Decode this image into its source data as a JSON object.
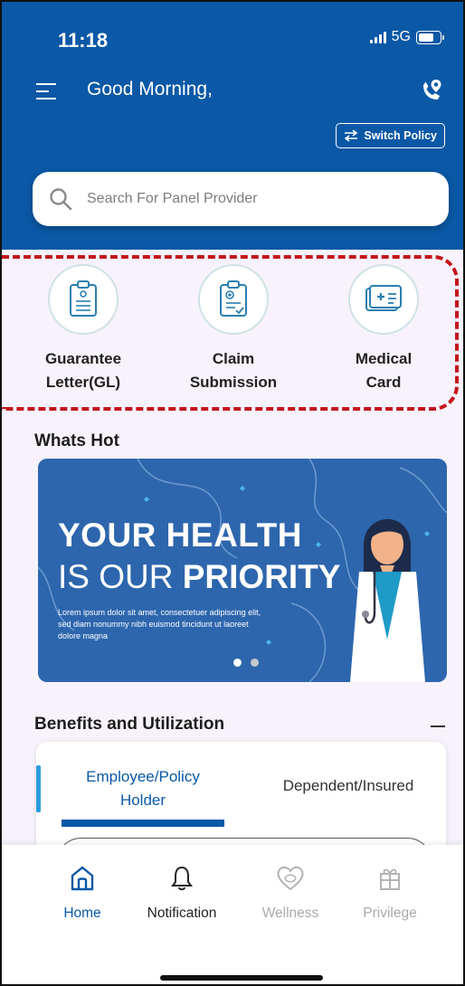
{
  "status_bar": {
    "time": "11:18",
    "network": "5G"
  },
  "header": {
    "greeting": "Good Morning,",
    "switch_policy_label": "Switch Policy",
    "background_color": "#0a58a6"
  },
  "search": {
    "placeholder": "Search For Panel Provider"
  },
  "quick_actions": [
    {
      "label_line1": "Guarantee",
      "label_line2": "Letter(GL)",
      "icon": "clipboard-document-icon"
    },
    {
      "label_line1": "Claim",
      "label_line2": "Submission",
      "icon": "clipboard-medical-icon"
    },
    {
      "label_line1": "Medical",
      "label_line2": "Card",
      "icon": "medical-card-icon"
    }
  ],
  "whats_hot": {
    "title": "Whats Hot",
    "banner": {
      "line1": "YOUR HEALTH",
      "line2_light": "IS OUR",
      "line2_bold": "PRIORITY",
      "body": "Lorem ipsum dolor sit amet, consectetuer adipiscing elit, sed diam nonummy nibh euismod tincidunt ut laoreet dolore magna"
    },
    "carousel_total": 2,
    "carousel_active": 1
  },
  "benefits": {
    "title": "Benefits and Utilization",
    "tabs": [
      {
        "label_line1": "Employee/Policy",
        "label_line2": "Holder",
        "active": true
      },
      {
        "label_line1": "Dependent/Insured",
        "label_line2": "",
        "active": false
      }
    ]
  },
  "bottom_nav": [
    {
      "label": "Home",
      "icon": "home-icon",
      "active": true
    },
    {
      "label": "Notification",
      "icon": "bell-icon",
      "active": false
    },
    {
      "label": "Wellness",
      "icon": "wellness-icon",
      "active": false
    },
    {
      "label": "Privilege",
      "icon": "gift-icon",
      "active": false
    }
  ],
  "colors": {
    "primary": "#0a58a6",
    "highlight_dash": "#c3161c",
    "accent": "#2a9be0"
  }
}
